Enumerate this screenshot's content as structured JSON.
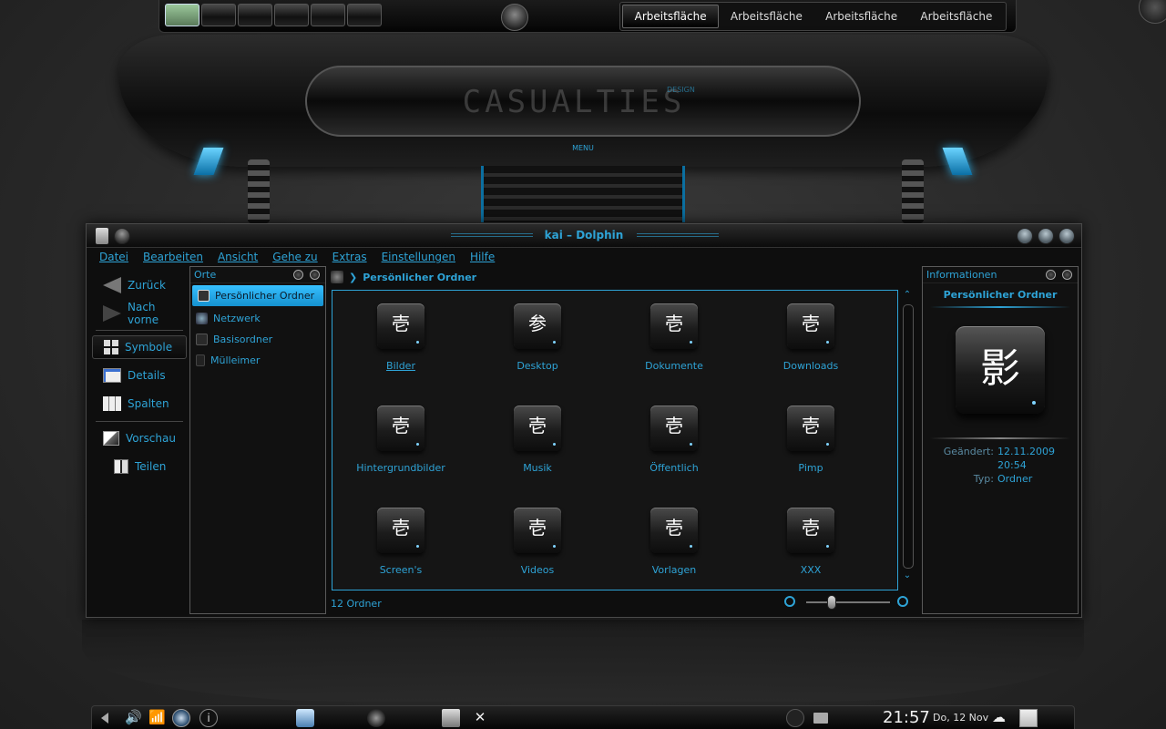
{
  "pager": {
    "desktops": [
      "Arbeitsfläche",
      "Arbeitsfläche",
      "Arbeitsfläche",
      "Arbeitsfläche"
    ],
    "active_index": 0
  },
  "wallpaper": {
    "logo_text": "CASUALTIES",
    "logo_small": "DESIGN",
    "menu_label": "MENU"
  },
  "window": {
    "title": "kai – Dolphin",
    "menu": [
      "Datei",
      "Bearbeiten",
      "Ansicht",
      "Gehe zu",
      "Extras",
      "Einstellungen",
      "Hilfe"
    ]
  },
  "nav": {
    "back": "Zurück",
    "forward": "Nach vorne",
    "view_icons": "Symbole",
    "view_details": "Details",
    "view_columns": "Spalten",
    "preview": "Vorschau",
    "share": "Teilen"
  },
  "places": {
    "title": "Orte",
    "items": [
      "Persönlicher Ordner",
      "Netzwerk",
      "Basisordner",
      "Mülleimer"
    ]
  },
  "main": {
    "breadcrumb": "Persönlicher Ordner",
    "folders": [
      "Bilder",
      "Desktop",
      "Dokumente",
      "Downloads",
      "Hintergrundbilder",
      "Musik",
      "Öffentlich",
      "Pimp",
      "Screen's",
      "Videos",
      "Vorlagen",
      "XXX"
    ],
    "status": "12 Ordner",
    "zoom_level": 0.28
  },
  "info": {
    "title": "Informationen",
    "selected": "Persönlicher Ordner",
    "modified_label": "Geändert:",
    "modified_date": "12.11.2009",
    "modified_time": "20:54",
    "type_label": "Typ:",
    "type_value": "Ordner"
  },
  "taskbar": {
    "time": "21:57",
    "date": "Do, 12 Nov"
  },
  "colors": {
    "accent": "#2ea3d6",
    "selection": "#37c0ff"
  }
}
